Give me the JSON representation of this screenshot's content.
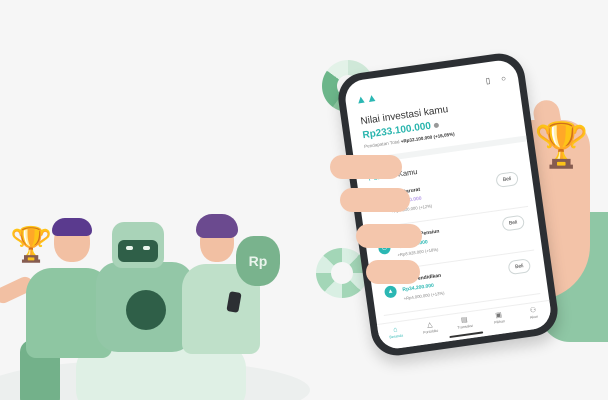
{
  "app": {
    "nilai_label": "Nilai investasi kamu",
    "nilai_value": "Rp233.100.000",
    "gain_label": "Pendapatan Total",
    "gain_value": "+Rp32.100.000 (+16,05%)"
  },
  "portfolio": {
    "title_colored": "Portfolio",
    "title_dark": "Kamu",
    "cards": [
      {
        "name": "Dana Darurat",
        "value": "Rp65.000.000",
        "gain": "+Rp7.000.000 (+12%)",
        "button": "Beli",
        "color": "#b79ce8",
        "icon": "shield-icon"
      },
      {
        "name": "Persiapan Pensiun",
        "value": "Rp59.800.000",
        "gain": "+Rp8.928.000 (+18%)",
        "button": "Beli",
        "color": "#2bb7b3",
        "icon": "clock-icon"
      },
      {
        "name": "Dana Pendidikan",
        "value": "Rp34.200.000",
        "gain": "+Rp4.000.000 (+13%)",
        "button": "Beli",
        "color": "#2bb7b3",
        "icon": "graduation-icon"
      }
    ]
  },
  "nav": [
    {
      "label": "Beranda",
      "icon": "home-icon",
      "active": true
    },
    {
      "label": "Portofolio",
      "icon": "portfolio-icon",
      "active": false
    },
    {
      "label": "Transaksi",
      "icon": "transaction-icon",
      "active": false
    },
    {
      "label": "Pilihan",
      "icon": "pilihan-icon",
      "active": false
    },
    {
      "label": "Akun",
      "icon": "account-icon",
      "active": false
    }
  ],
  "decor": {
    "moneybag_text": "Rp"
  },
  "colors": {
    "accent": "#2bb7b3",
    "green": "#8ec6a2",
    "background": "#f6f6f6"
  }
}
